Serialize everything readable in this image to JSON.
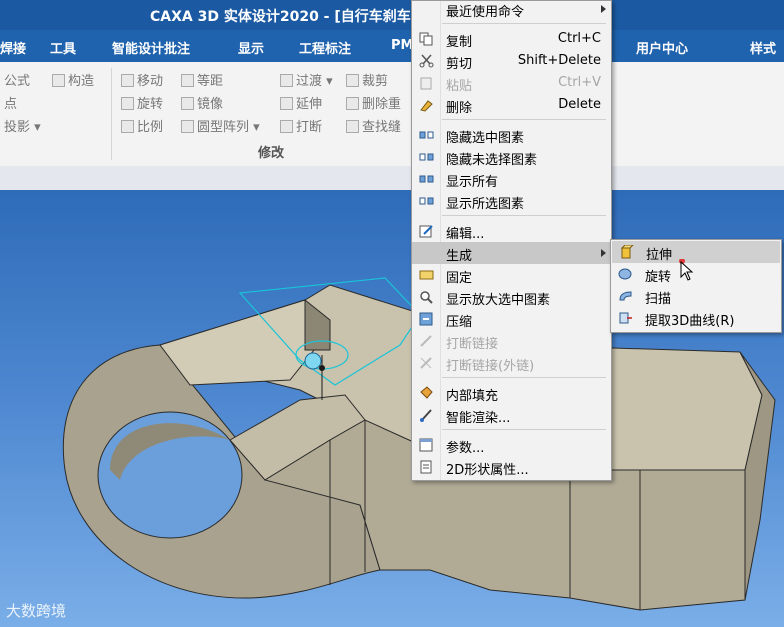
{
  "window": {
    "title": "CAXA 3D 实体设计2020 - [自行车刹车"
  },
  "menubar": {
    "tabs": [
      "焊接",
      "工具",
      "智能设计批注",
      "显示",
      "工程标注",
      "PM",
      "用户中心",
      "样式"
    ]
  },
  "ribbon": {
    "col1": [
      "公式",
      "点",
      "投影"
    ],
    "col1b": [
      "构造"
    ],
    "col2": [
      "移动",
      "旋转",
      "比例"
    ],
    "col3": [
      "等距",
      "镜像",
      "圆型阵列"
    ],
    "col4": [
      "过渡",
      "延伸",
      "打断"
    ],
    "col5": [
      "裁剪",
      "删除重",
      "查找缝"
    ],
    "group_label": "修改"
  },
  "context_menu": {
    "items": [
      {
        "label": "最近使用命令",
        "shortcut": "",
        "submenu": true,
        "disabled": false,
        "icon": "none"
      },
      {
        "label": "复制",
        "shortcut": "Ctrl+C",
        "submenu": false,
        "disabled": false,
        "icon": "copy-icon"
      },
      {
        "label": "剪切",
        "shortcut": "Shift+Delete",
        "submenu": false,
        "disabled": false,
        "icon": "scissors-icon"
      },
      {
        "label": "粘贴",
        "shortcut": "Ctrl+V",
        "submenu": false,
        "disabled": true,
        "icon": "paste-icon"
      },
      {
        "label": "删除",
        "shortcut": "Delete",
        "submenu": false,
        "disabled": false,
        "icon": "eraser-icon"
      },
      {
        "label": "隐藏选中图素",
        "shortcut": "",
        "submenu": false,
        "disabled": false,
        "icon": "hide-selected-icon"
      },
      {
        "label": "隐藏未选择图素",
        "shortcut": "",
        "submenu": false,
        "disabled": false,
        "icon": "hide-unselected-icon"
      },
      {
        "label": "显示所有",
        "shortcut": "",
        "submenu": false,
        "disabled": false,
        "icon": "show-all-icon"
      },
      {
        "label": "显示所选图素",
        "shortcut": "",
        "submenu": false,
        "disabled": false,
        "icon": "show-selected-icon"
      },
      {
        "label": "编辑...",
        "shortcut": "",
        "submenu": false,
        "disabled": false,
        "icon": "edit-icon"
      },
      {
        "label": "生成",
        "shortcut": "",
        "submenu": true,
        "disabled": false,
        "icon": "none",
        "highlighted": true
      },
      {
        "label": "固定",
        "shortcut": "",
        "submenu": false,
        "disabled": false,
        "icon": "fix-icon"
      },
      {
        "label": "显示放大选中图素",
        "shortcut": "",
        "submenu": false,
        "disabled": false,
        "icon": "zoom-selected-icon"
      },
      {
        "label": "压缩",
        "shortcut": "",
        "submenu": false,
        "disabled": false,
        "icon": "compress-icon"
      },
      {
        "label": "打断链接",
        "shortcut": "",
        "submenu": false,
        "disabled": true,
        "icon": "break-link-icon"
      },
      {
        "label": "打断链接(外链)",
        "shortcut": "",
        "submenu": false,
        "disabled": true,
        "icon": "break-external-link-icon"
      },
      {
        "label": "内部填充",
        "shortcut": "",
        "submenu": false,
        "disabled": false,
        "icon": "fill-icon"
      },
      {
        "label": "智能渲染...",
        "shortcut": "",
        "submenu": false,
        "disabled": false,
        "icon": "render-brush-icon"
      },
      {
        "label": "参数...",
        "shortcut": "",
        "submenu": false,
        "disabled": false,
        "icon": "parameters-icon"
      },
      {
        "label": "2D形状属性...",
        "shortcut": "",
        "submenu": false,
        "disabled": false,
        "icon": "shape-properties-icon"
      }
    ]
  },
  "submenu": {
    "items": [
      {
        "label": "拉伸",
        "icon": "extrude-icon",
        "highlighted": true
      },
      {
        "label": "旋转",
        "icon": "revolve-icon",
        "highlighted": false
      },
      {
        "label": "扫描",
        "icon": "sweep-icon",
        "highlighted": false
      },
      {
        "label": "提取3D曲线(R)",
        "icon": "extract-3d-curve-icon",
        "highlighted": false
      }
    ]
  },
  "watermark": "大数跨境"
}
